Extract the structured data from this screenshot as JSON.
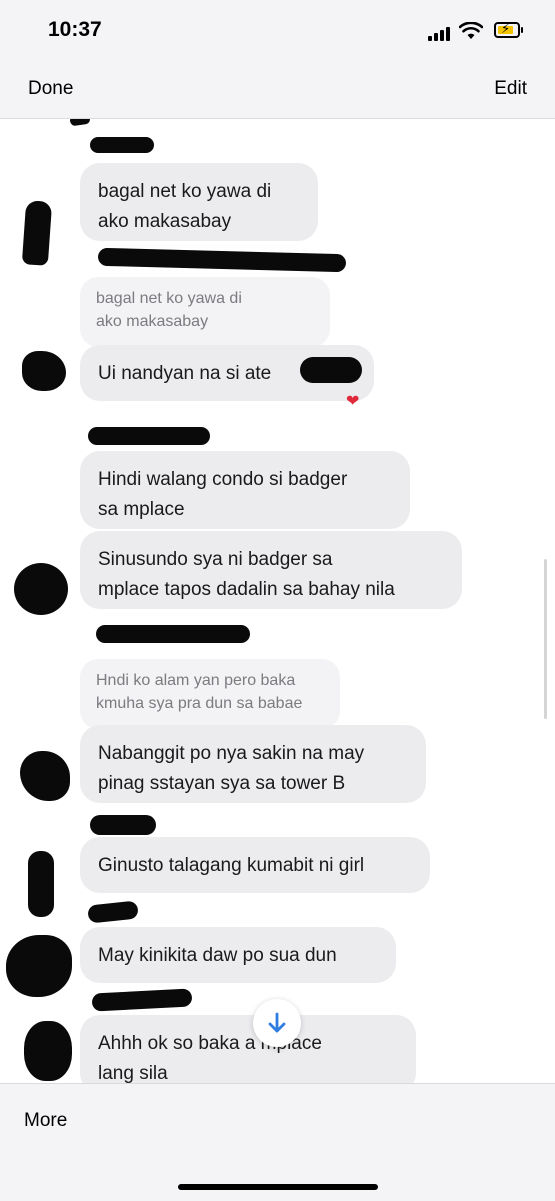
{
  "status_bar": {
    "time": "10:37",
    "battery_color": "#f2c400",
    "icons": [
      "signal-icon",
      "wifi-icon",
      "battery-charging-icon"
    ]
  },
  "nav": {
    "done_label": "Done",
    "edit_label": "Edit"
  },
  "messages": [
    {
      "text": "bagal net ko yawa di\nako makasabay"
    },
    {
      "reply_quote": "bagal net ko yawa di\nako makasabay",
      "text": "Ui nandyan na si ate",
      "reaction": "❤"
    },
    {
      "text": "Hindi walang condo si badger\nsa mplace"
    },
    {
      "text": "Sinusundo sya ni badger sa\nmplace tapos dadalin sa bahay nila"
    },
    {
      "reply_quote": "Hndi ko alam yan pero baka\nkmuha sya pra dun sa babae",
      "text": "Nabanggit po nya sakin na may\npinag sstayan sya sa tower B"
    },
    {
      "text": "Ginusto talagang kumabit ni girl"
    },
    {
      "text": "May kinikita daw po sua dun"
    },
    {
      "text": "Ahhh ok so baka     a mplace\nlang sila"
    }
  ],
  "scroll_button": {
    "icon": "arrow-down-icon",
    "color": "#2f7de1"
  },
  "bottom_bar": {
    "more_label": "More"
  },
  "colors": {
    "bubble_bg": "#ececef",
    "bar_bg": "#f4f4f6",
    "redaction": "#0a0a0a",
    "heart": "#e0293a"
  }
}
